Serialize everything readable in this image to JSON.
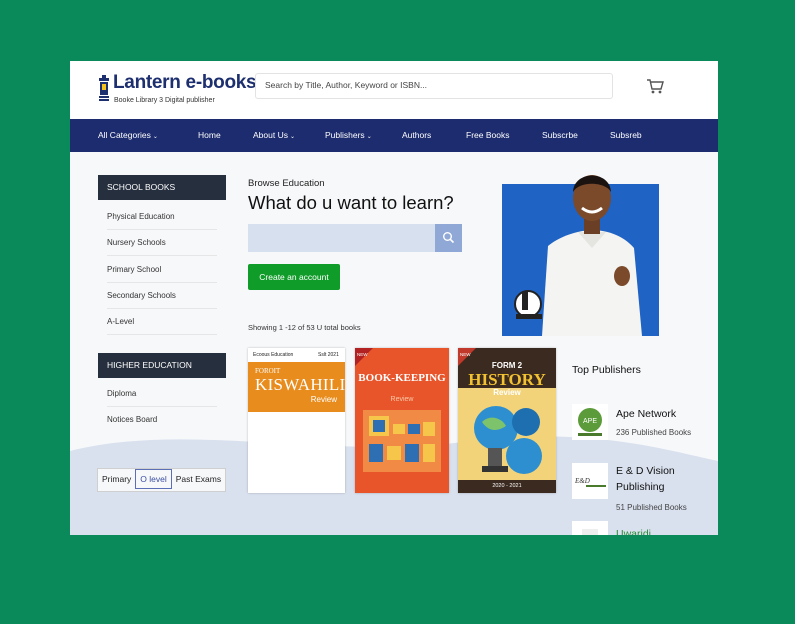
{
  "logo": {
    "title": "Lantern e-books",
    "tagline": "Booke Library 3 Digital publisher"
  },
  "search": {
    "placeholder": "Search by Title, Author, Keyword or ISBN..."
  },
  "nav": [
    {
      "label": "All Categories",
      "caret": true
    },
    {
      "label": "Home",
      "caret": false
    },
    {
      "label": "About Us",
      "caret": true
    },
    {
      "label": "Publishers",
      "caret": true
    },
    {
      "label": "Authors",
      "caret": false
    },
    {
      "label": "Free Books",
      "caret": false
    },
    {
      "label": "Subscrbe",
      "caret": false
    },
    {
      "label": "Subsreb",
      "caret": false
    }
  ],
  "sidebar": {
    "school_heading": "SCHOOL BOOKS",
    "school_items": [
      "Physical Education",
      "Nursery Schools",
      "Primary School",
      "Secondary Schools",
      "A-Level"
    ],
    "higher_heading": "HIGHER EDUCATION",
    "higher_items": [
      "Diploma",
      "Notices Board"
    ],
    "levels": [
      "Primary",
      "O level",
      "Past Exams"
    ]
  },
  "main": {
    "breadcrumb": "Browse Education",
    "headline": "What do u want to learn?",
    "create_label": "Create an account",
    "showing": "Showing 1 -12 of 53 U total books"
  },
  "books": [
    {
      "publisher": "Ecoous Education",
      "edition": "Sslt 2021",
      "pre": "FOROIT",
      "title": "KISWAHILI",
      "sub": "Review"
    },
    {
      "title": "BOOK-KEEPING",
      "sub": "Review",
      "badge": "NEW"
    },
    {
      "pre": "FORM 2",
      "title": "HISTORY",
      "sub": "Review",
      "year": "2020 - 2021",
      "badge": "NEW"
    }
  ],
  "publishers": {
    "title": "Top Publishers",
    "items": [
      {
        "name": "Ape Network",
        "count": "236 Published Books",
        "logo_text": "APE"
      },
      {
        "name": "E & D Vision Publishing",
        "count": "51 Published Books",
        "logo_text": "E&D"
      },
      {
        "name": "Uwaridi",
        "count": "",
        "logo_text": ""
      }
    ]
  },
  "colors": {
    "page_bg": "#0a8a5a",
    "nav_bg": "#1d2c6e",
    "accent_green": "#109c29",
    "hero_blue": "#1f63c4"
  }
}
